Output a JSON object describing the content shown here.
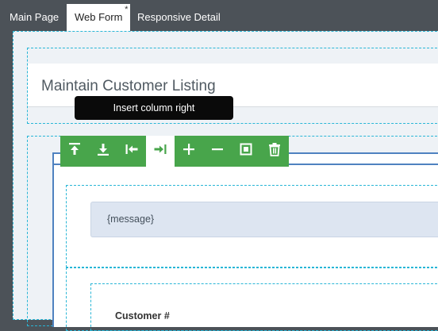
{
  "tabs": [
    {
      "label": "Main Page",
      "active": false
    },
    {
      "label": "Web Form",
      "active": true,
      "dirty_marker": "*"
    },
    {
      "label": "Responsive Detail",
      "active": false
    }
  ],
  "page": {
    "title": "Maintain Customer Listing"
  },
  "tooltip": {
    "text": "Insert column right"
  },
  "toolbar": {
    "buttons": [
      {
        "icon": "move-to-top-icon",
        "active": false
      },
      {
        "icon": "move-to-bottom-icon",
        "active": false
      },
      {
        "icon": "insert-column-left-icon",
        "active": false
      },
      {
        "icon": "insert-column-right-icon",
        "active": true
      },
      {
        "icon": "plus-icon",
        "active": false
      },
      {
        "icon": "minus-icon",
        "active": false
      },
      {
        "icon": "select-container-icon",
        "active": false
      },
      {
        "icon": "trash-icon",
        "active": false
      }
    ]
  },
  "form": {
    "message_placeholder": "{message}",
    "field_label": "Customer #"
  },
  "colors": {
    "tabbar": "#4c5258",
    "toolbar_green": "#48a54b",
    "guide_dash": "#29b6d6",
    "panel_border": "#4f82c0",
    "message_bg": "#dde5f1"
  }
}
